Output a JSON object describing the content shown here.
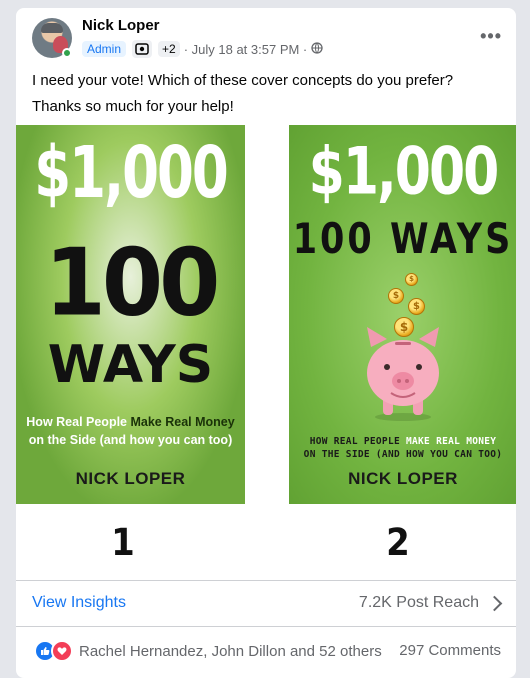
{
  "post": {
    "author": "Nick Loper",
    "admin_badge": "Admin",
    "extra_badges": "+2",
    "timestamp": "· July 18 at 3:57 PM ·",
    "text_line1": "I need your vote! Which of these cover concepts do you prefer?",
    "text_line2": "Thanks so much for your help!"
  },
  "covers": [
    {
      "price": "$1,000",
      "big_number": "100",
      "ways": "WAYS",
      "subtitle_pre": "How Real People ",
      "subtitle_highlight": "Make Real Money",
      "subtitle_post": "on the Side (and how you can too)",
      "author": "NICK LOPER",
      "label": "1"
    },
    {
      "price": "$1,000",
      "ways_line": "100 WAYS",
      "subtitle_pre": "HOW REAL PEOPLE ",
      "subtitle_highlight": "MAKE REAL MONEY",
      "subtitle_post": "ON THE SIDE (AND HOW YOU CAN TOO)",
      "author": "NICK LOPER",
      "label": "2",
      "coin_symbol": "$"
    }
  ],
  "footer": {
    "insights_link": "View Insights",
    "reach": "7.2K Post Reach",
    "reactors": "Rachel Hernandez, John Dillon and 52 others",
    "comments": "297 Comments"
  },
  "colors": {
    "accent": "#1877f2",
    "online": "#31a24c",
    "cover_green": "#72b440",
    "love": "#f33e58"
  },
  "icons": [
    "avatar",
    "badge-icon",
    "globe-icon",
    "more-icon",
    "chevron-right-icon",
    "like-icon",
    "love-icon",
    "piggy-bank-icon",
    "coin-icon"
  ]
}
